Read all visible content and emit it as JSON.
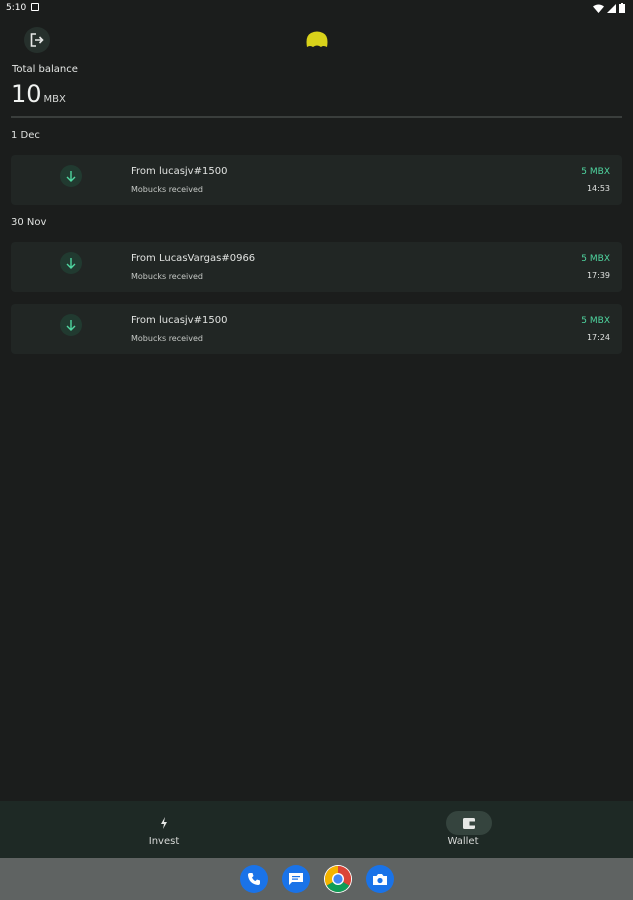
{
  "status_bar": {
    "time": "5:10"
  },
  "header": {
    "total_label": "Total balance",
    "balance": "10",
    "unit": "MBX"
  },
  "groups": [
    {
      "date": "1 Dec",
      "items": [
        {
          "title": "From lucasjv#1500",
          "subtitle": "Mobucks received",
          "amount": "5 MBX",
          "time": "14:53"
        }
      ]
    },
    {
      "date": "30 Nov",
      "items": [
        {
          "title": "From LucasVargas#0966",
          "subtitle": "Mobucks received",
          "amount": "5 MBX",
          "time": "17:39"
        },
        {
          "title": "From lucasjv#1500",
          "subtitle": "Mobucks received",
          "amount": "5 MBX",
          "time": "17:24"
        }
      ]
    }
  ],
  "nav": {
    "invest_label": "Invest",
    "wallet_label": "Wallet",
    "active": "wallet"
  },
  "colors": {
    "background": "#1b1d1c",
    "accent_green": "#4fd6a0",
    "logo_yellow": "#d9d21a"
  },
  "icons": [
    "logout-icon",
    "app-logo-icon",
    "arrow-down-icon",
    "bolt-icon",
    "wallet-icon",
    "phone-icon",
    "messages-icon",
    "chrome-icon",
    "camera-icon"
  ]
}
